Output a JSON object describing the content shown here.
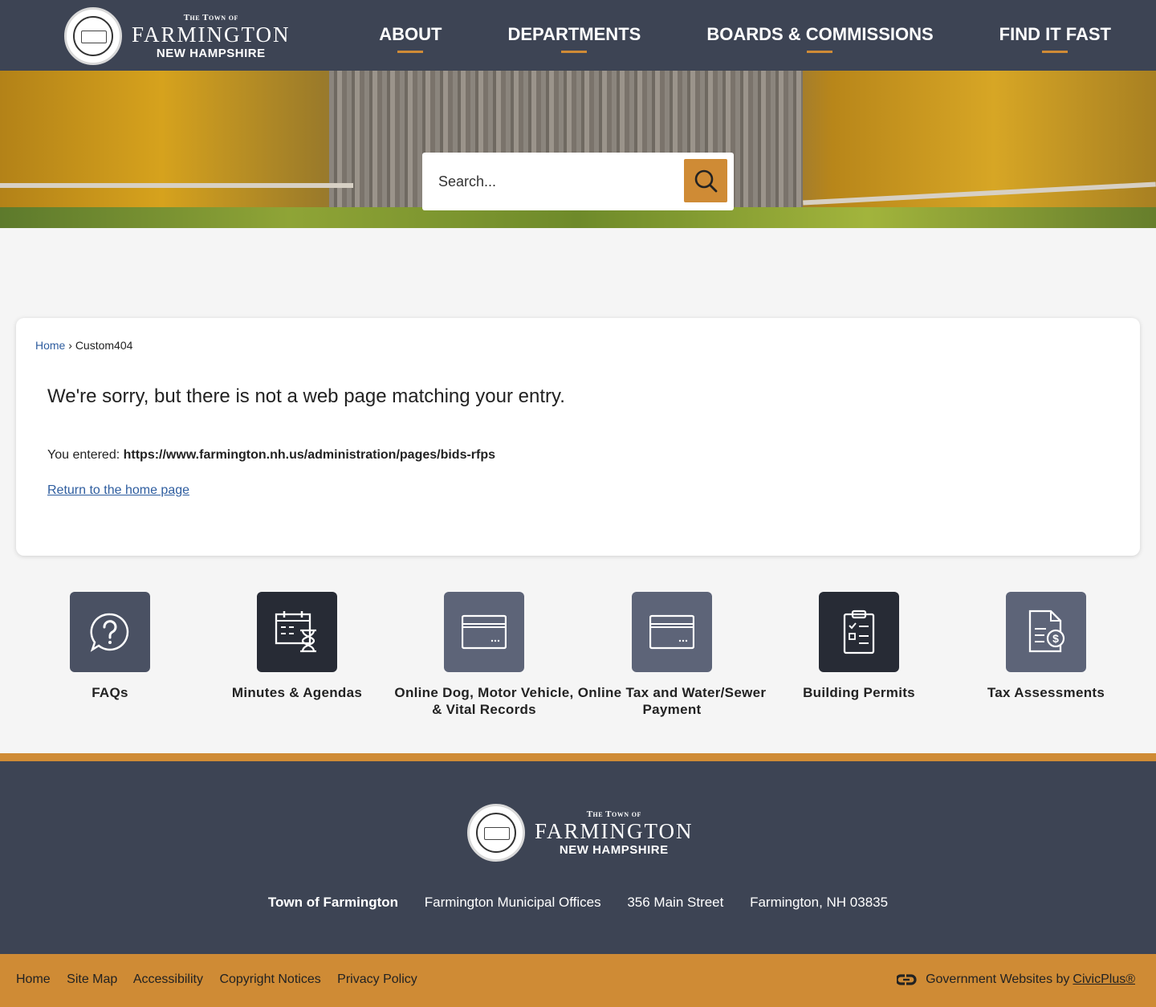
{
  "header": {
    "logo": {
      "top": "The Town of",
      "name": "Farmington",
      "state": "New Hampshire"
    },
    "nav": [
      "ABOUT",
      "DEPARTMENTS",
      "BOARDS & COMMISSIONS",
      "FIND IT FAST"
    ]
  },
  "search": {
    "placeholder": "Search..."
  },
  "breadcrumb": {
    "home": "Home",
    "current": "Custom404"
  },
  "error": {
    "message": "We're sorry, but there is not a web page matching your entry.",
    "entered_label": "You entered: ",
    "entered_url": "https://www.farmington.nh.us/administration/pages/bids-rfps",
    "return_link": "Return to the home page"
  },
  "quick_links": [
    {
      "label": "FAQs",
      "icon": "question-bubble-icon",
      "color": "#4a5163"
    },
    {
      "label": "Minutes & Agendas",
      "icon": "calendar-hourglass-icon",
      "color": "#272b35"
    },
    {
      "label": "Online Dog, Motor Vehicle, & Vital Records",
      "icon": "credit-card-icon",
      "color": "#5d6478"
    },
    {
      "label": "Online Tax and Water/Sewer Payment",
      "icon": "credit-card-icon",
      "color": "#5d6478"
    },
    {
      "label": "Building Permits",
      "icon": "clipboard-checklist-icon",
      "color": "#272b35"
    },
    {
      "label": "Tax Assessments",
      "icon": "document-dollar-icon",
      "color": "#5d6478"
    }
  ],
  "footer": {
    "logo": {
      "top": "The Town of",
      "name": "Farmington",
      "state": "New Hampshire"
    },
    "org": "Town of Farmington",
    "building": "Farmington Municipal Offices",
    "street": "356 Main Street",
    "city": "Farmington, NH 03835"
  },
  "bottom_links": [
    "Home",
    "Site Map",
    "Accessibility",
    "Copyright Notices",
    "Privacy Policy"
  ],
  "credit": {
    "text": "Government Websites by",
    "link": "CivicPlus®"
  },
  "colors": {
    "header": "#3d4454",
    "accent": "#cf8b35",
    "link": "#2e5d9f"
  }
}
